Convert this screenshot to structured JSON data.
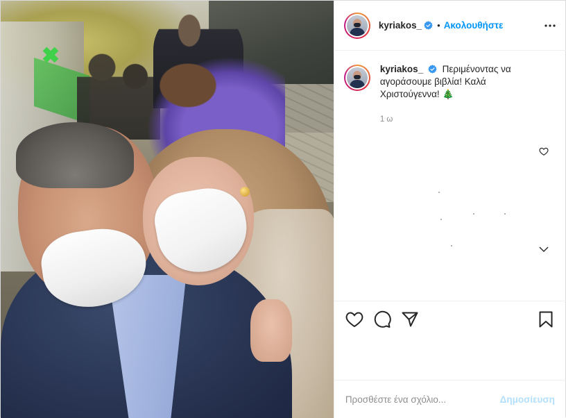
{
  "post": {
    "username": "kyriakos_",
    "verified": true,
    "separator": "•",
    "follow_label": "Ακολουθήστε",
    "more_icon": "more-horizontal-icon",
    "caption": {
      "username": "kyriakos_",
      "text": "Περιμένοντας να αγοράσουμε βιβλία! Καλά Χριστούγεννα!",
      "emoji": "🎄"
    },
    "time_ago": "1 ω",
    "actions": [
      "heart-icon",
      "comment-icon",
      "share-icon",
      "bookmark-icon"
    ],
    "comment": {
      "placeholder": "Προσθέστε ένα σχόλιο...",
      "post_label": "Δημοσίευση"
    },
    "colors": {
      "accent": "#0095f6",
      "post_disabled": "#b2dffc",
      "muted": "#8e8e8e",
      "text": "#262626",
      "border": "#dbdbdb"
    }
  }
}
